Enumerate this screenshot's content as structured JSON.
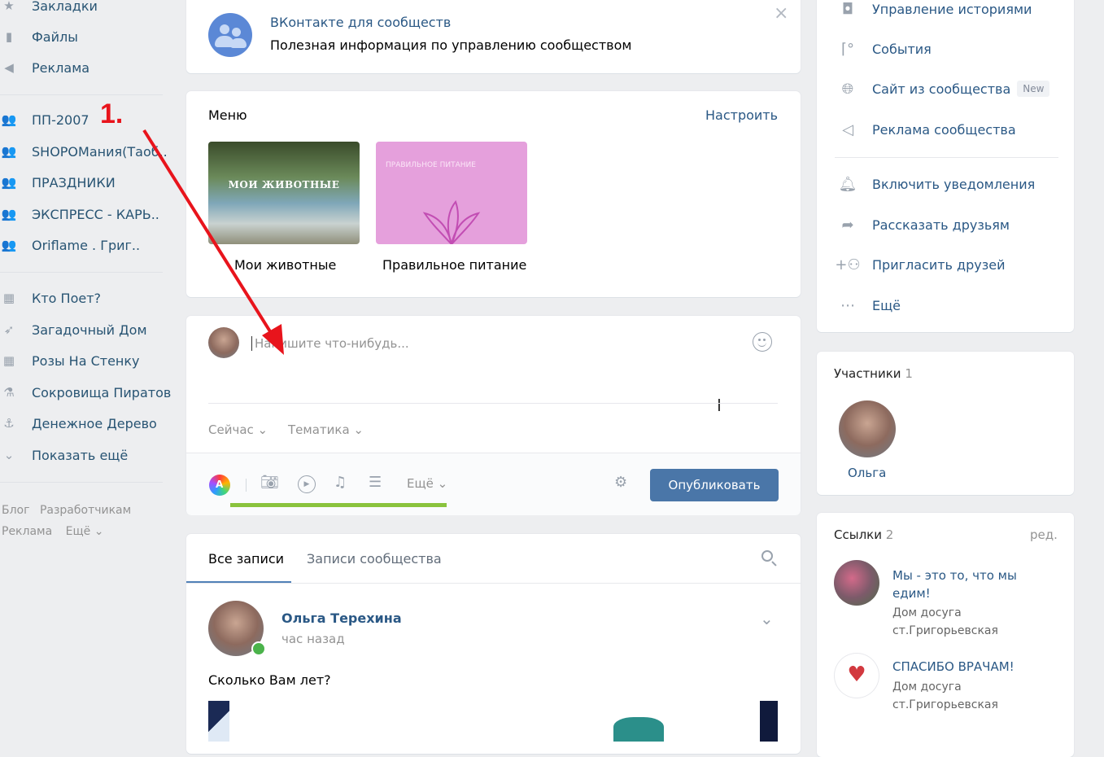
{
  "sidebar": {
    "top_items": [
      {
        "label": "Закладки",
        "icon": "star-icon"
      },
      {
        "label": "Файлы",
        "icon": "file-icon"
      },
      {
        "label": "Реклама",
        "icon": "megaphone-icon"
      }
    ],
    "groups": [
      {
        "label": "ПП-2007",
        "icon": "group-icon"
      },
      {
        "label": "SHOPОМания(Таоб..",
        "icon": "group-icon"
      },
      {
        "label": "ПРАЗДНИКИ",
        "icon": "group-icon"
      },
      {
        "label": "ЭКСПРЕСС - КАРЬ..",
        "icon": "group-icon"
      },
      {
        "label": "Oriflame . Григ..",
        "icon": "group-icon"
      }
    ],
    "apps": [
      {
        "label": "Кто Поет?",
        "icon": "app-icon"
      },
      {
        "label": "Загадочный Дом",
        "icon": "rocket-icon"
      },
      {
        "label": "Розы На Стенку",
        "icon": "app-icon"
      },
      {
        "label": "Сокровища Пиратов",
        "icon": "flask-icon"
      },
      {
        "label": "Денежное Дерево",
        "icon": "anchor-icon"
      },
      {
        "label": "Показать ещё",
        "icon": "chevron-down-icon"
      }
    ],
    "footer": {
      "blog": "Блог",
      "dev": "Разработчикам",
      "ads": "Реклама",
      "more": "Ещё"
    }
  },
  "annotation": {
    "label": "1.",
    "color": "#e8141c"
  },
  "promo": {
    "title": "ВКонтакте для сообществ",
    "text": "Полезная информация по управлению сообществом"
  },
  "menu": {
    "title": "Меню",
    "configure": "Настроить",
    "items": [
      {
        "caption": "Мои животные",
        "thumb_text": "МОИ ЖИВОТНЫЕ"
      },
      {
        "caption": "Правильное питание",
        "thumb_text": "ПРАВИЛЬНОЕ ПИТАНИЕ"
      }
    ]
  },
  "composer": {
    "placeholder": "Напишите что-нибудь...",
    "when": "Сейчас",
    "topic": "Тематика",
    "more": "Ещё",
    "publish": "Опубликовать",
    "underline_color": "#8ac33d"
  },
  "feed": {
    "tabs": [
      "Все записи",
      "Записи сообщества"
    ],
    "post": {
      "author": "Ольга Терехина",
      "time": "час назад",
      "text": "Сколько Вам лет?"
    }
  },
  "right_menu": {
    "items_top": [
      {
        "label": "Управление историями",
        "icon": "stories-icon"
      },
      {
        "label": "События",
        "icon": "events-icon"
      },
      {
        "label": "Сайт из сообщества",
        "icon": "globe-icon",
        "badge": "New"
      },
      {
        "label": "Реклама сообщества",
        "icon": "megaphone-icon"
      }
    ],
    "items_bottom": [
      {
        "label": "Включить уведомления",
        "icon": "bell-icon"
      },
      {
        "label": "Рассказать друзьям",
        "icon": "share-icon"
      },
      {
        "label": "Пригласить друзей",
        "icon": "add-friend-icon"
      },
      {
        "label": "Ещё",
        "icon": "more-icon"
      }
    ]
  },
  "members": {
    "title": "Участники",
    "count": "1",
    "name": "Ольга"
  },
  "links": {
    "title": "Ссылки",
    "count": "2",
    "edit": "ред.",
    "items": [
      {
        "title": "Мы - это то, что мы едим!",
        "sub": "Дом досуга ст.Григорьевская"
      },
      {
        "title": "СПАСИБО ВРАЧАМ!",
        "sub": "Дом досуга ст.Григорьевская"
      }
    ]
  }
}
